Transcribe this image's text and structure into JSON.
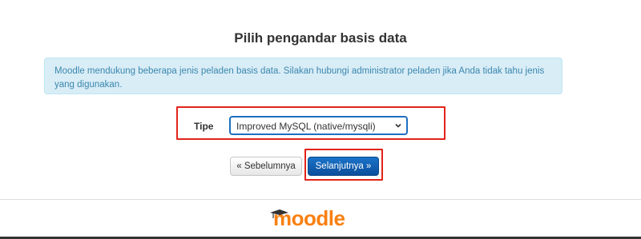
{
  "page": {
    "title": "Pilih pengandar basis data",
    "info": "Moodle mendukung beberapa jenis peladen basis data. Silakan hubungi administrator peladen jika Anda tidak tahu jenis yang digunakan."
  },
  "form": {
    "type_label": "Tipe",
    "type_selected": "Improved MySQL (native/mysqli)"
  },
  "buttons": {
    "previous": "« Sebelumnya",
    "next": "Selanjutnya »"
  },
  "footer": {
    "logo_text": "moodle"
  },
  "colors": {
    "accent": "#0b4f9c",
    "highlight": "#e2231a",
    "info_bg": "#d9edf7",
    "logo": "#f98012"
  },
  "icons": {
    "select": "chevron-down-icon",
    "logo_cap": "graduation-cap-icon"
  }
}
